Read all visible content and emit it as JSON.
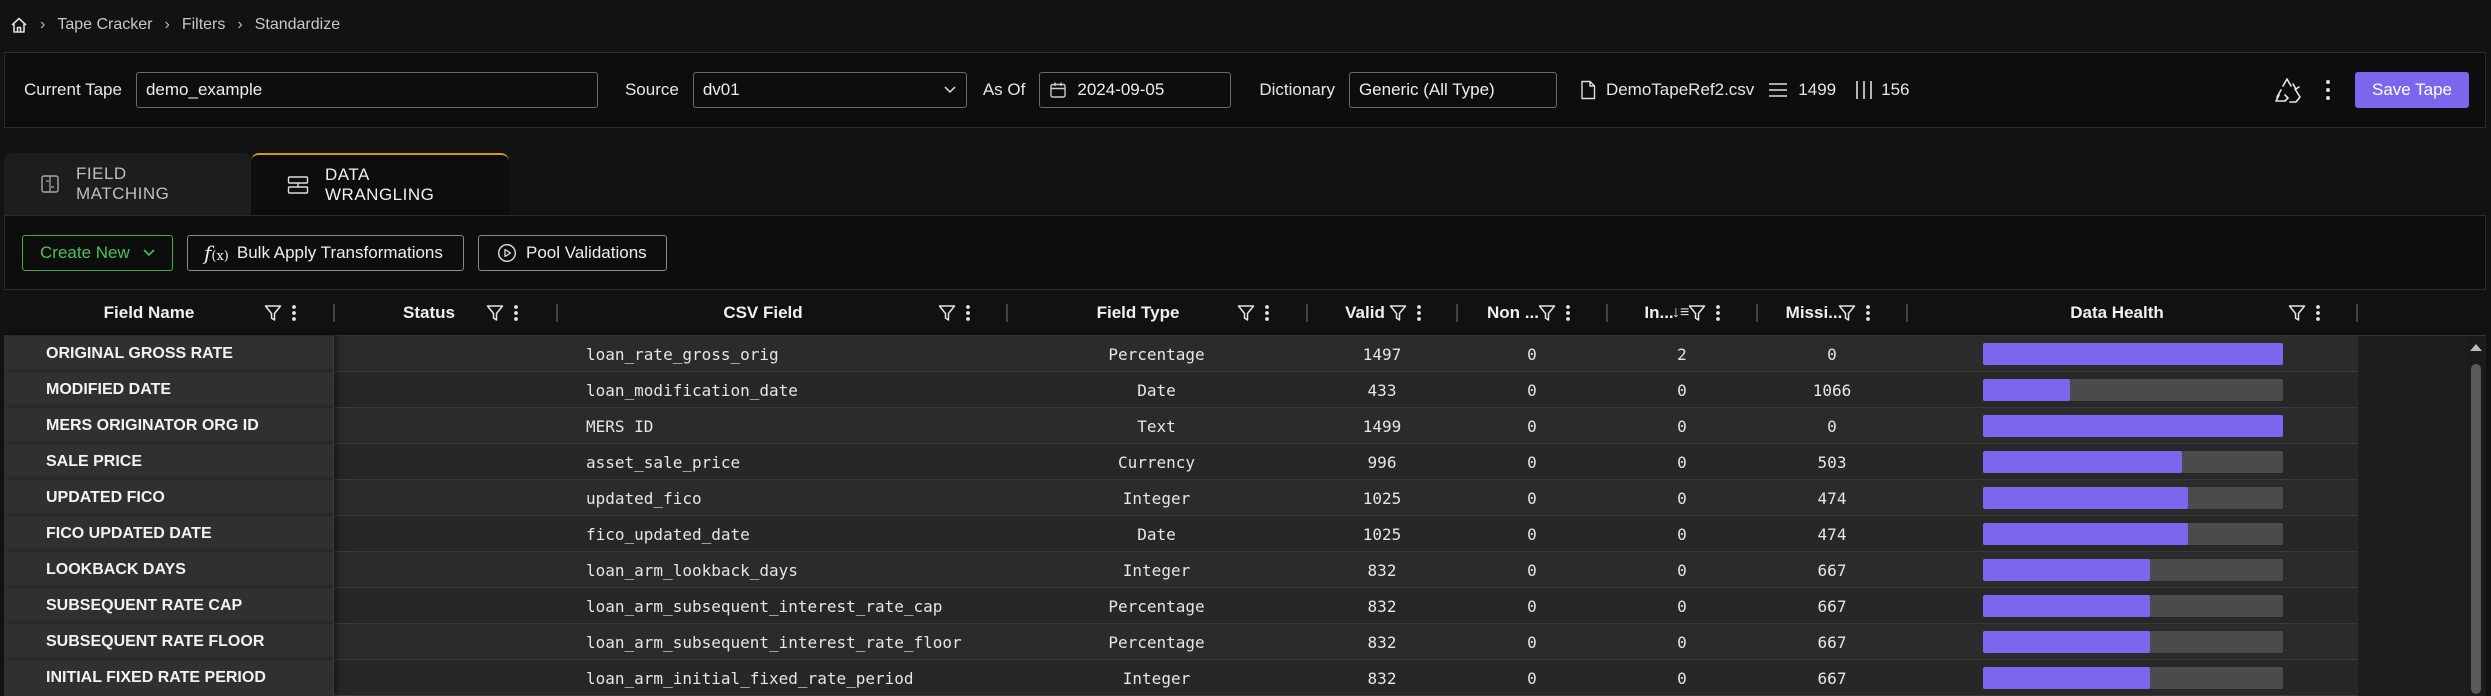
{
  "breadcrumb": {
    "items": [
      "Tape Cracker",
      "Filters",
      "Standardize"
    ]
  },
  "topbar": {
    "current_tape_label": "Current Tape",
    "current_tape_value": "demo_example",
    "source_label": "Source",
    "source_value": "dv01",
    "as_of_label": "As Of",
    "as_of_value": "2024-09-05",
    "dictionary_label": "Dictionary",
    "dictionary_value": "Generic (All Type)",
    "file_name": "DemoTapeRef2.csv",
    "rows_count": "1499",
    "cols_count": "156",
    "save_label": "Save Tape"
  },
  "tabs": [
    {
      "label": "FIELD MATCHING",
      "active": false
    },
    {
      "label": "DATA WRANGLING",
      "active": true
    }
  ],
  "toolbar": {
    "create_new": "Create New",
    "bulk_apply": "Bulk Apply Transformations",
    "pool_validations": "Pool Validations"
  },
  "columns": {
    "field_name": "Field Name",
    "status": "Status",
    "csv_field": "CSV Field",
    "field_type": "Field Type",
    "valid": "Valid",
    "non": "Non ...",
    "in": "In...",
    "missing": "Missi...",
    "data_health": "Data Health"
  },
  "rows": [
    {
      "field_name": "ORIGINAL GROSS RATE",
      "csv_field": "loan_rate_gross_orig",
      "field_type": "Percentage",
      "valid": "1497",
      "non": "0",
      "in": "2",
      "missing": "0",
      "health": 0.999
    },
    {
      "field_name": "MODIFIED DATE",
      "csv_field": "loan_modification_date",
      "field_type": "Date",
      "valid": "433",
      "non": "0",
      "in": "0",
      "missing": "1066",
      "health": 0.289
    },
    {
      "field_name": "MERS ORIGINATOR ORG ID",
      "csv_field": "MERS ID",
      "field_type": "Text",
      "valid": "1499",
      "non": "0",
      "in": "0",
      "missing": "0",
      "health": 1.0
    },
    {
      "field_name": "SALE PRICE",
      "csv_field": "asset_sale_price",
      "field_type": "Currency",
      "valid": "996",
      "non": "0",
      "in": "0",
      "missing": "503",
      "health": 0.664
    },
    {
      "field_name": "UPDATED FICO",
      "csv_field": "updated_fico",
      "field_type": "Integer",
      "valid": "1025",
      "non": "0",
      "in": "0",
      "missing": "474",
      "health": 0.684
    },
    {
      "field_name": "FICO UPDATED DATE",
      "csv_field": "fico_updated_date",
      "field_type": "Date",
      "valid": "1025",
      "non": "0",
      "in": "0",
      "missing": "474",
      "health": 0.684
    },
    {
      "field_name": "LOOKBACK DAYS",
      "csv_field": "loan_arm_lookback_days",
      "field_type": "Integer",
      "valid": "832",
      "non": "0",
      "in": "0",
      "missing": "667",
      "health": 0.555
    },
    {
      "field_name": "SUBSEQUENT RATE CAP",
      "csv_field": "loan_arm_subsequent_interest_rate_cap",
      "field_type": "Percentage",
      "valid": "832",
      "non": "0",
      "in": "0",
      "missing": "667",
      "health": 0.555
    },
    {
      "field_name": "SUBSEQUENT RATE FLOOR",
      "csv_field": "loan_arm_subsequent_interest_rate_floor",
      "field_type": "Percentage",
      "valid": "832",
      "non": "0",
      "in": "0",
      "missing": "667",
      "health": 0.555
    },
    {
      "field_name": "INITIAL FIXED RATE PERIOD",
      "csv_field": "loan_arm_initial_fixed_rate_period",
      "field_type": "Integer",
      "valid": "832",
      "non": "0",
      "in": "0",
      "missing": "667",
      "health": 0.555
    }
  ],
  "colors": {
    "accent": "#7a67ee",
    "create_new": "#4cc157",
    "tab_active_border": "#c9972b"
  }
}
